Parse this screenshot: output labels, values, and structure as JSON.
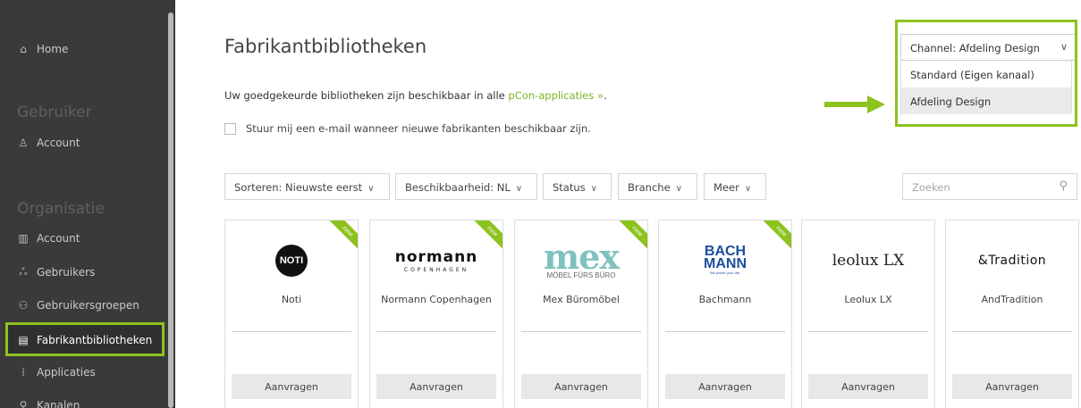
{
  "sidebar": {
    "items": [
      {
        "icon": "home-icon",
        "glyph": "⌂",
        "label": "Home"
      },
      {
        "icon": "user-icon",
        "glyph": "♙",
        "label": "Account"
      },
      {
        "icon": "building-icon",
        "glyph": "▥",
        "label": "Account"
      },
      {
        "icon": "users-icon",
        "glyph": "ஃ",
        "label": "Gebruikers"
      },
      {
        "icon": "user-groups-icon",
        "glyph": "⚇",
        "label": "Gebruikersgroepen"
      },
      {
        "icon": "book-icon",
        "glyph": "▤",
        "label": "Fabrikantbibliotheken"
      },
      {
        "icon": "grid-icon",
        "glyph": "⁞",
        "label": "Applicaties"
      },
      {
        "icon": "channels-icon",
        "glyph": "⚲",
        "label": "Kanalen"
      }
    ],
    "headings": [
      "Gebruiker",
      "Organisatie"
    ]
  },
  "main": {
    "title": "Fabrikantbibliotheken",
    "description_prefix": "Uw goedgekeurde bibliotheken zijn beschikbaar in alle ",
    "description_link": "pCon-applicaties »",
    "description_suffix": ".",
    "notify_label": "Stuur mij een e-mail wanneer nieuwe fabrikanten beschikbaar zijn."
  },
  "channel": {
    "selected": "Channel: Afdeling Design",
    "options": [
      "Standard (Eigen kanaal)",
      "Afdeling Design"
    ]
  },
  "filters": [
    {
      "label": "Sorteren: Nieuwste eerst"
    },
    {
      "label": "Beschikbaarheid: NL"
    },
    {
      "label": "Status"
    },
    {
      "label": "Branche"
    },
    {
      "label": "Meer"
    }
  ],
  "search": {
    "placeholder": "Zoeken"
  },
  "cards": [
    {
      "name": "Noti",
      "badge": "new",
      "button": "Aanvragen",
      "logo_text": "NOTI"
    },
    {
      "name": "Normann Copenhagen",
      "badge": "new",
      "button": "Aanvragen",
      "logo_text": "normann",
      "logo_sub": "COPENHAGEN"
    },
    {
      "name": "Mex Büromöbel",
      "badge": "new",
      "button": "Aanvragen",
      "logo_text": "mex",
      "logo_sub": "MÖBEL FÜRS BÜRO"
    },
    {
      "name": "Bachmann",
      "badge": "new",
      "button": "Aanvragen",
      "logo_text": "BACH",
      "logo_text2": "MANN",
      "logo_sub": "We power your life."
    },
    {
      "name": "Leolux LX",
      "badge": "",
      "button": "Aanvragen",
      "logo_text": "leolux LX"
    },
    {
      "name": "AndTradition",
      "badge": "",
      "button": "Aanvragen",
      "logo_text": "&Tradition"
    }
  ],
  "colors": {
    "accent": "#8ec21f",
    "sidebar_bg": "#3a3a3a",
    "link": "#82b32a",
    "mex_teal": "#7fc1be",
    "bachmann_blue": "#1a4f9c"
  }
}
